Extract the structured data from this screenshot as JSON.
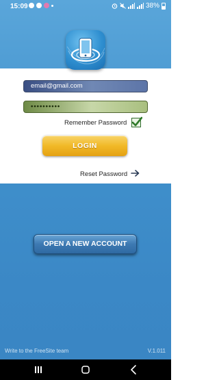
{
  "status_bar": {
    "time": "15:09",
    "battery": "38%"
  },
  "login": {
    "email_value": "email@gmail.com",
    "password_value": "••••••••••",
    "remember_label": "Remember Password",
    "remember_checked": true,
    "login_label": "LOGIN",
    "reset_label": "Reset Password"
  },
  "new_account": {
    "label": "OPEN A NEW ACCOUNT"
  },
  "footer": {
    "contact_text": "Write to the FreeSite team",
    "version": "V.1.011"
  },
  "icons": {
    "logo": "freesite-logo-icon",
    "check": "checkmark-icon",
    "reset_arrow": "arrow-right-icon",
    "nav_recents": "recents-icon",
    "nav_home": "home-icon",
    "nav_back": "back-icon"
  },
  "colors": {
    "background": "#3f8fcb",
    "login_button": "#f1b928",
    "new_account_button": "#3d79b2",
    "check": "#2f7a2a"
  }
}
